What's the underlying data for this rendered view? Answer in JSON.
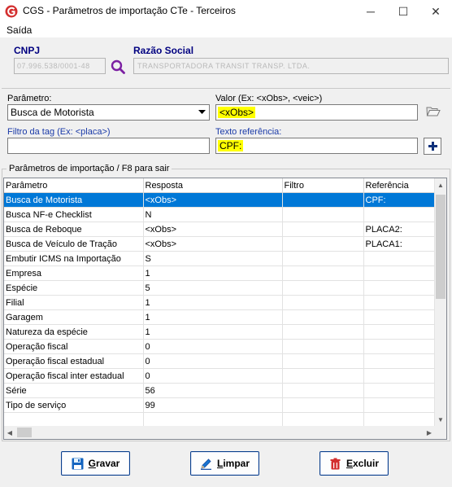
{
  "window": {
    "title": "CGS - Parâmetros de importação CTe - Terceiros",
    "minimize": "─",
    "maximize": "☐",
    "close": "✕"
  },
  "menu": {
    "items": [
      "Saída"
    ]
  },
  "company": {
    "cnpj_label": "CNPJ",
    "cnpj_value": "07.996.538/0001-48",
    "razao_label": "Razão Social",
    "razao_value": "TRANSPORTADORA TRANSIT TRANSP. LTDA."
  },
  "form": {
    "parametro_label": "Parâmetro:",
    "parametro_value": "Busca de Motorista",
    "valor_label": "Valor (Ex: <xObs>, <veic>)",
    "valor_value": "<xObs>",
    "filtro_label": "Filtro da tag (Ex: <placa>)",
    "filtro_value": "",
    "texto_label": "Texto referência:",
    "texto_value": "CPF:"
  },
  "grid": {
    "group_title": "Parâmetros de importação /  F8 para sair",
    "columns": [
      "Parâmetro",
      "Resposta",
      "Filtro",
      "Referência"
    ],
    "rows": [
      [
        "Busca de Motorista",
        "<xObs>",
        "",
        "CPF:"
      ],
      [
        "Busca NF-e Checklist",
        "N",
        "",
        ""
      ],
      [
        "Busca de Reboque",
        "<xObs>",
        "",
        "PLACA2:"
      ],
      [
        "Busca de Veículo de Tração",
        "<xObs>",
        "",
        "PLACA1:"
      ],
      [
        "Embutir ICMS na Importação",
        "S",
        "",
        ""
      ],
      [
        "Empresa",
        "1",
        "",
        ""
      ],
      [
        "Espécie",
        "5",
        "",
        ""
      ],
      [
        "Filial",
        "1",
        "",
        ""
      ],
      [
        "Garagem",
        "1",
        "",
        ""
      ],
      [
        "Natureza da espécie",
        "1",
        "",
        ""
      ],
      [
        "Operação fiscal",
        "0",
        "",
        ""
      ],
      [
        "Operação fiscal estadual",
        "0",
        "",
        ""
      ],
      [
        "Operação fiscal inter estadual",
        "0",
        "",
        ""
      ],
      [
        "Série",
        "56",
        "",
        ""
      ],
      [
        "Tipo de serviço",
        "99",
        "",
        ""
      ],
      [
        "",
        "",
        "",
        ""
      ]
    ],
    "selected_row": 0
  },
  "buttons": {
    "gravar": {
      "underline": "G",
      "rest": "ravar"
    },
    "limpar": {
      "underline": "L",
      "rest": "impar"
    },
    "excluir": {
      "underline": "E",
      "rest": "xcluir"
    }
  },
  "colors": {
    "selection": "#0078d7",
    "highlight": "#ffff00",
    "label_blue": "#000080",
    "icon_purple": "#7b1fa2"
  }
}
